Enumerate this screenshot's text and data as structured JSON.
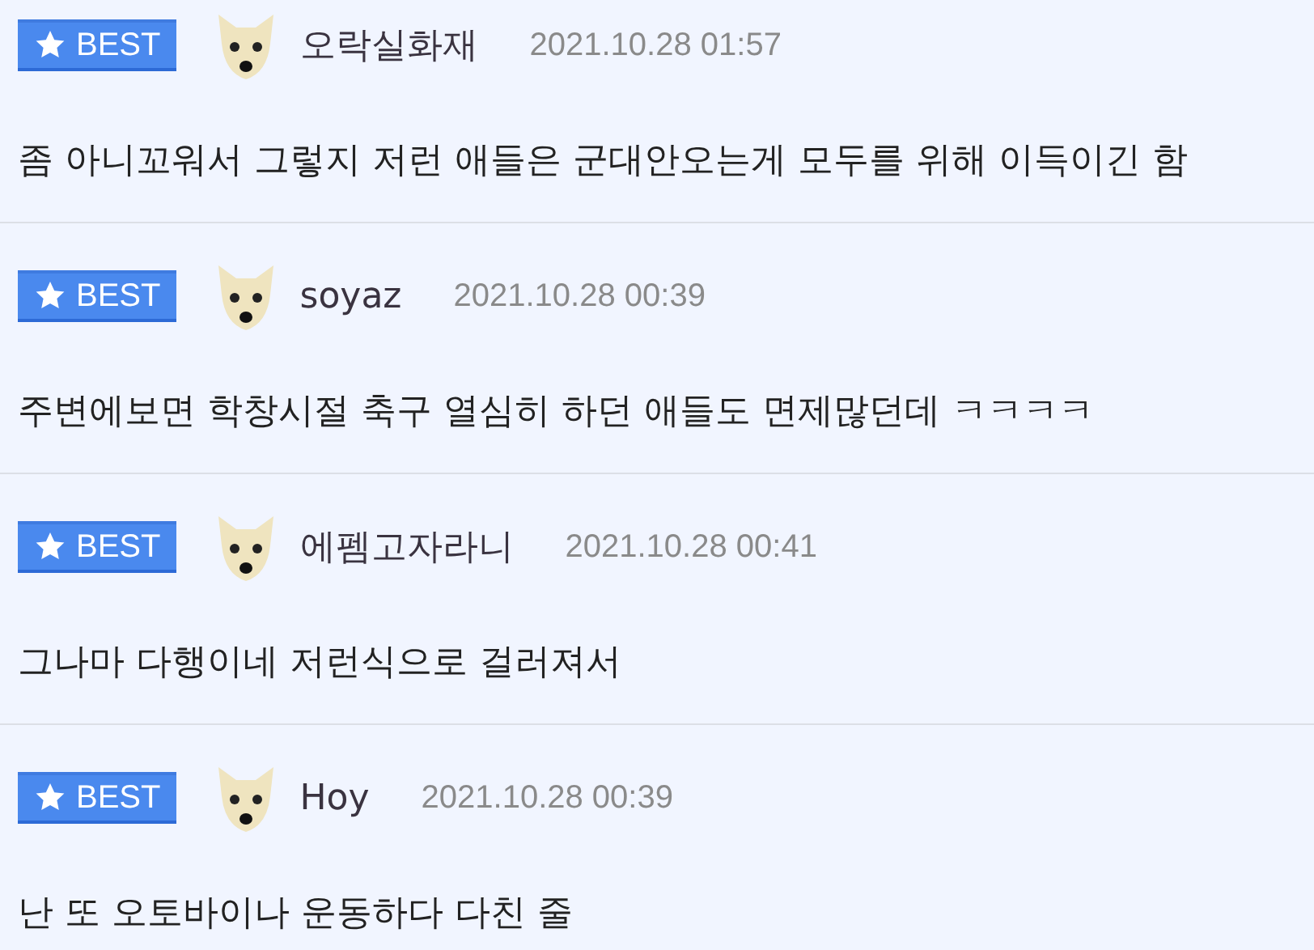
{
  "comments": [
    {
      "badge": "BEST",
      "username": "오락실화재",
      "date": "2021.10.28 01:57",
      "text": "좀 아니꼬워서 그렇지 저런 애들은 군대안오는게 모두를 위해 이득이긴 함"
    },
    {
      "badge": "BEST",
      "username": "soyaz",
      "date": "2021.10.28 00:39",
      "text": "주변에보면 학창시절 축구 열심히 하던 애들도 면제많던데 ㅋㅋㅋㅋ"
    },
    {
      "badge": "BEST",
      "username": "에펨고자라니",
      "date": "2021.10.28 00:41",
      "text": "그나마 다행이네 저런식으로 걸러져서"
    },
    {
      "badge": "BEST",
      "username": "Hoy",
      "date": "2021.10.28 00:39",
      "text": "난 또 오토바이나 운동하다 다친 줄"
    }
  ]
}
